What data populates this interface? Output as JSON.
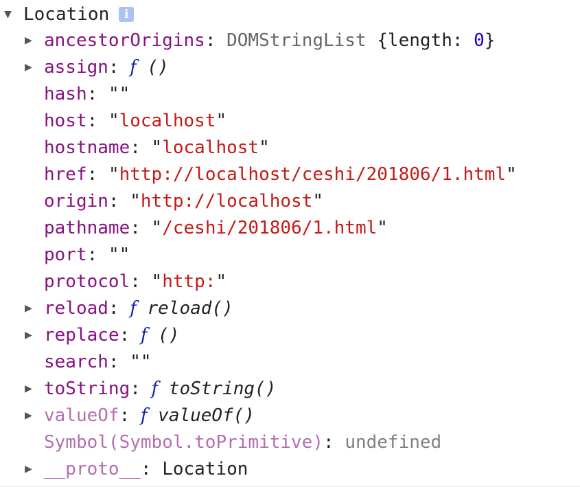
{
  "object": {
    "title": "Location",
    "info_icon": "info-icon"
  },
  "props": {
    "ancestorOrigins": {
      "key": "ancestorOrigins",
      "type": "DOMStringList",
      "open": "{length: ",
      "len": "0",
      "close": "}"
    },
    "assign": {
      "key": "assign",
      "f": "f",
      "sig": " ()"
    },
    "hash": {
      "key": "hash",
      "value": "\"\""
    },
    "host": {
      "key": "host",
      "value": "localhost"
    },
    "hostname": {
      "key": "hostname",
      "value": "localhost"
    },
    "href": {
      "key": "href",
      "value": "http://localhost/ceshi/201806/1.html"
    },
    "origin": {
      "key": "origin",
      "value": "http://localhost"
    },
    "pathname": {
      "key": "pathname",
      "value": "/ceshi/201806/1.html"
    },
    "port": {
      "key": "port",
      "value": "\"\""
    },
    "protocol": {
      "key": "protocol",
      "value": "http:"
    },
    "reload": {
      "key": "reload",
      "f": "f",
      "sig": " reload()"
    },
    "replace": {
      "key": "replace",
      "f": "f",
      "sig": " ()"
    },
    "search": {
      "key": "search",
      "value": "\"\""
    },
    "toString": {
      "key": "toString",
      "f": "f",
      "sig": " toString()"
    },
    "valueOf": {
      "key": "valueOf",
      "f": "f",
      "sig": " valueOf()"
    },
    "symbol": {
      "key": "Symbol(Symbol.toPrimitive)",
      "value": "undefined"
    },
    "proto": {
      "key": "__proto__",
      "value": "Location"
    }
  },
  "colors": {
    "key": "#881280",
    "string": "#c41a16",
    "number": "#1c00cf",
    "function": "#0d22aa",
    "undefined": "#808080"
  }
}
